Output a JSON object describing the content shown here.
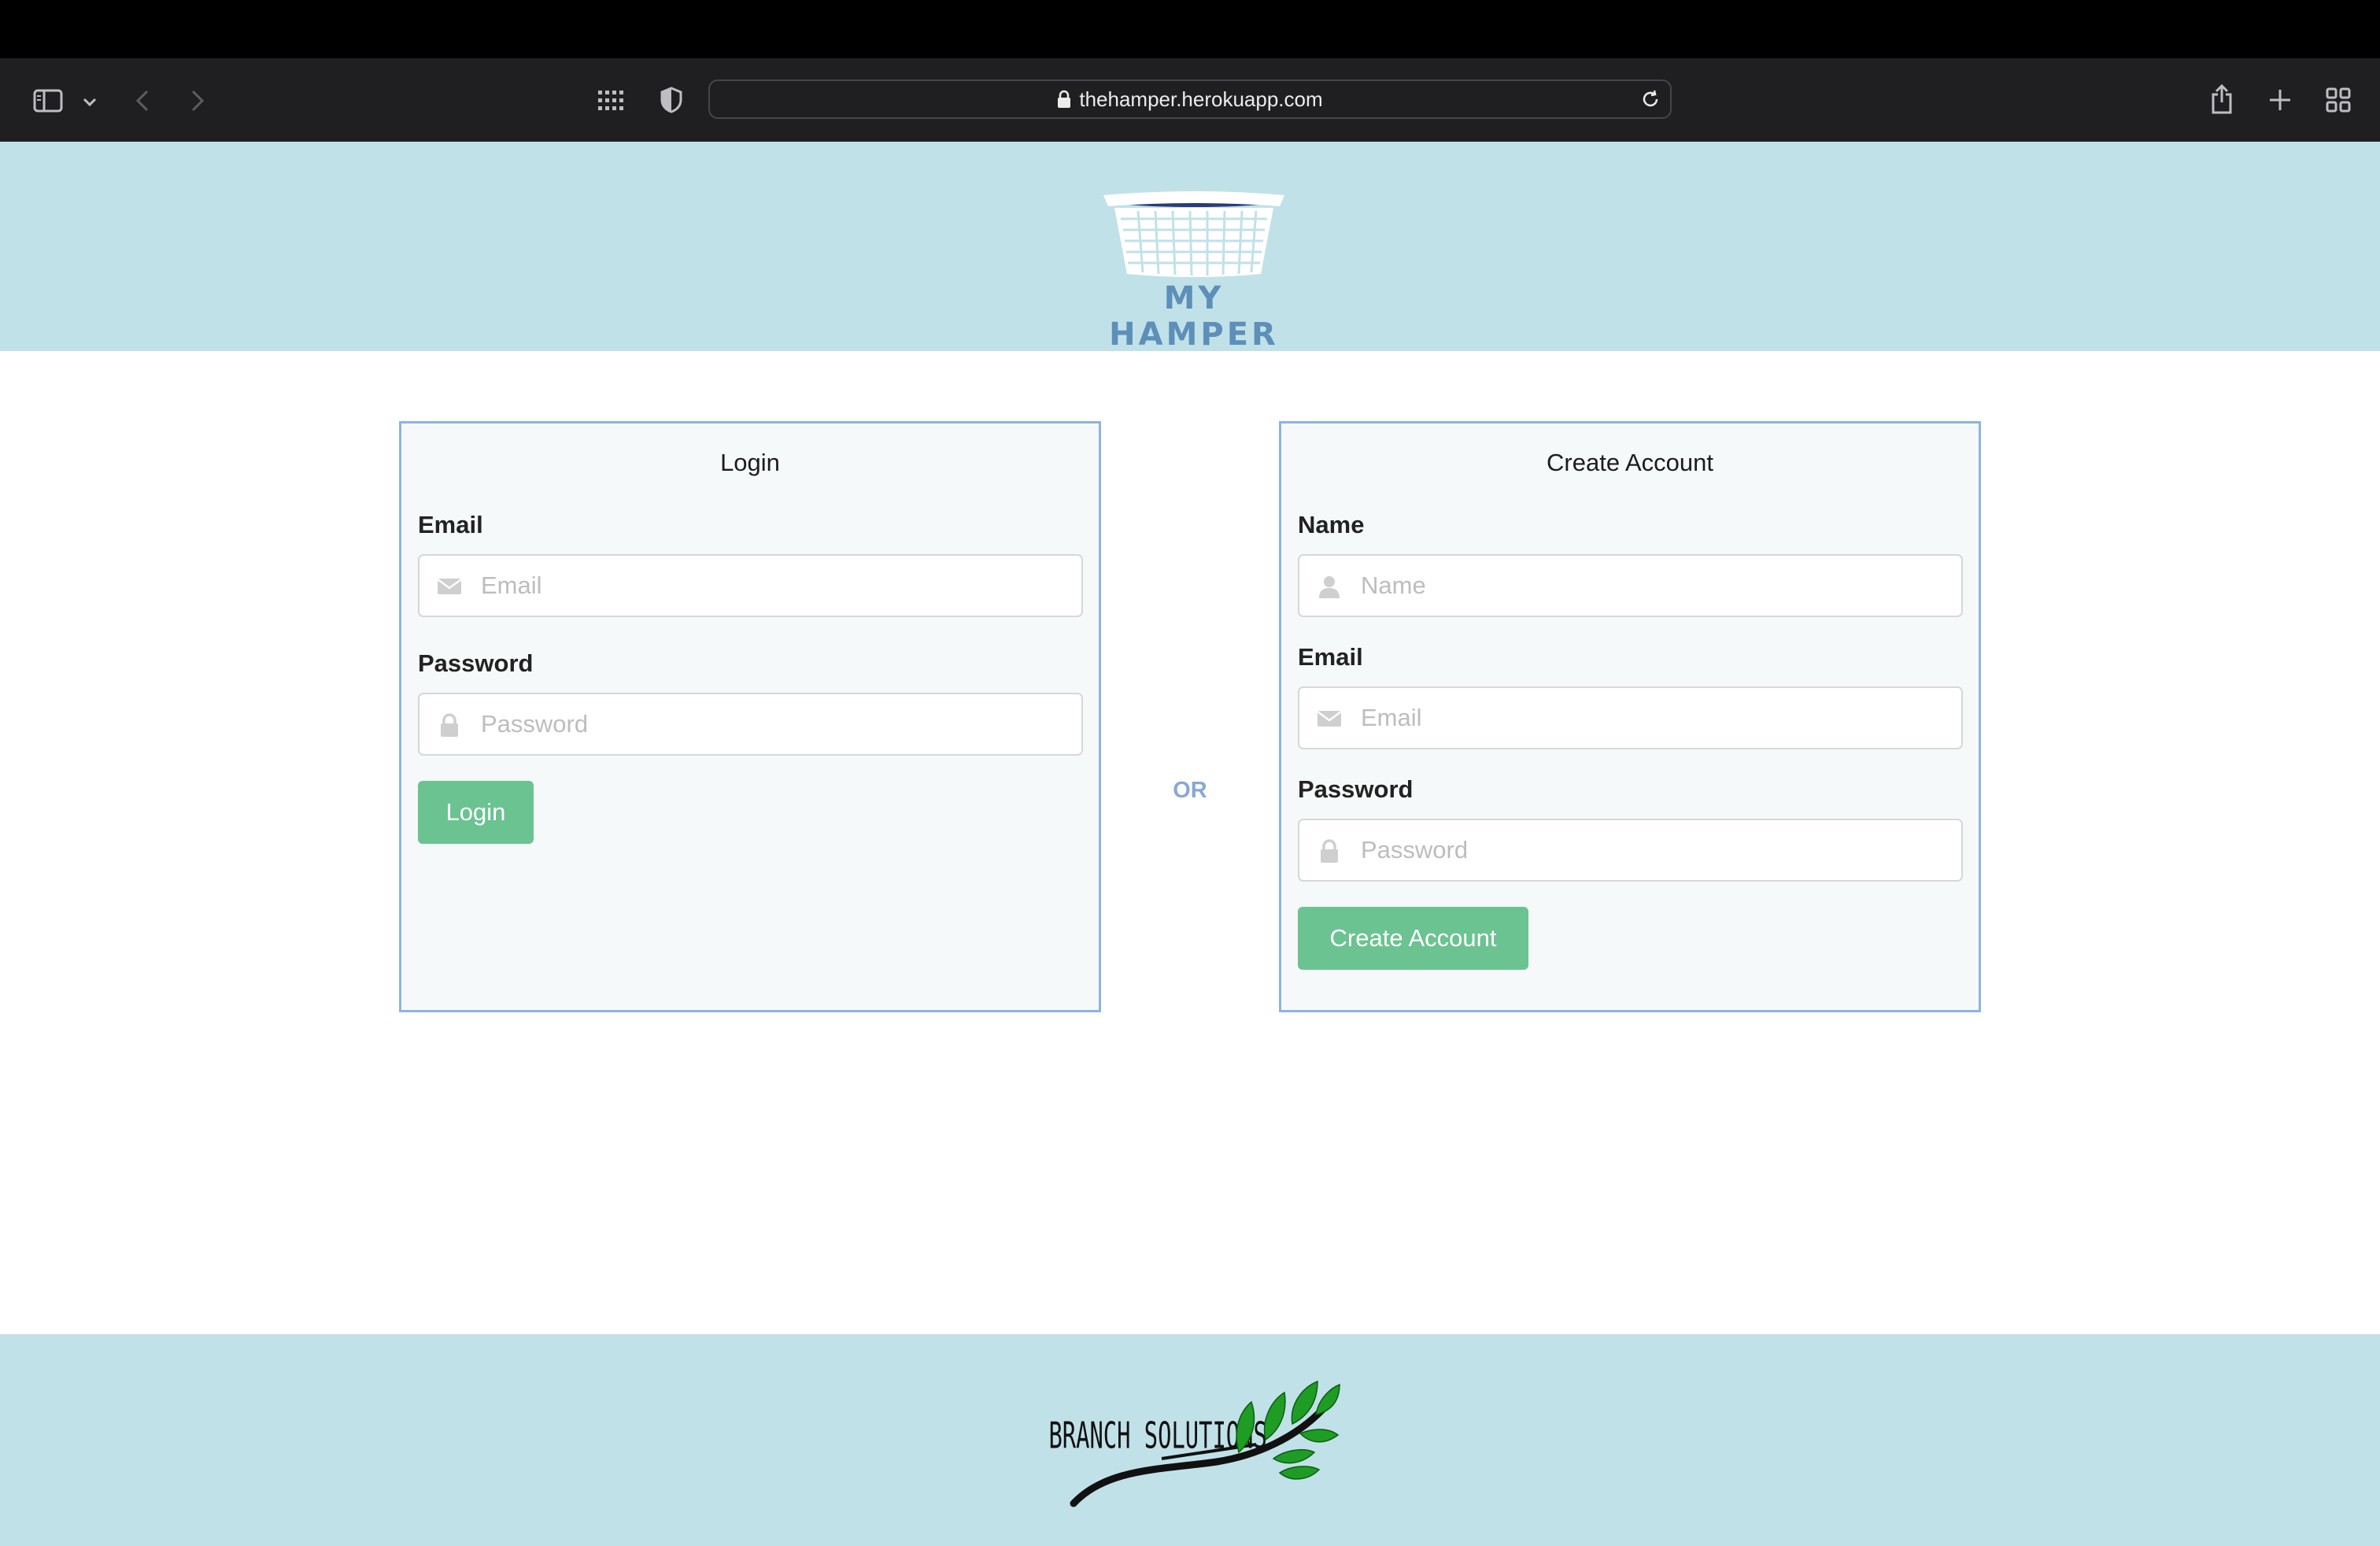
{
  "browser": {
    "url": "thehamper.herokuapp.com"
  },
  "header": {
    "logo_text": "MY HAMPER",
    "background": "#c1e1e8"
  },
  "login": {
    "title": "Login",
    "email_label": "Email",
    "email_placeholder": "Email",
    "password_label": "Password",
    "password_placeholder": "Password",
    "submit_label": "Login"
  },
  "separator": {
    "text": "OR"
  },
  "create_account": {
    "title": "Create Account",
    "name_label": "Name",
    "name_placeholder": "Name",
    "email_label": "Email",
    "email_placeholder": "Email",
    "password_label": "Password",
    "password_placeholder": "Password",
    "submit_label": "Create Account"
  },
  "footer": {
    "logo_text": "Branch Solutions"
  },
  "colors": {
    "accent_button": "#6bc391",
    "panel_border": "#8fb3e3",
    "or_text": "#8aa8d6",
    "logo_text": "#5d8fb9"
  }
}
